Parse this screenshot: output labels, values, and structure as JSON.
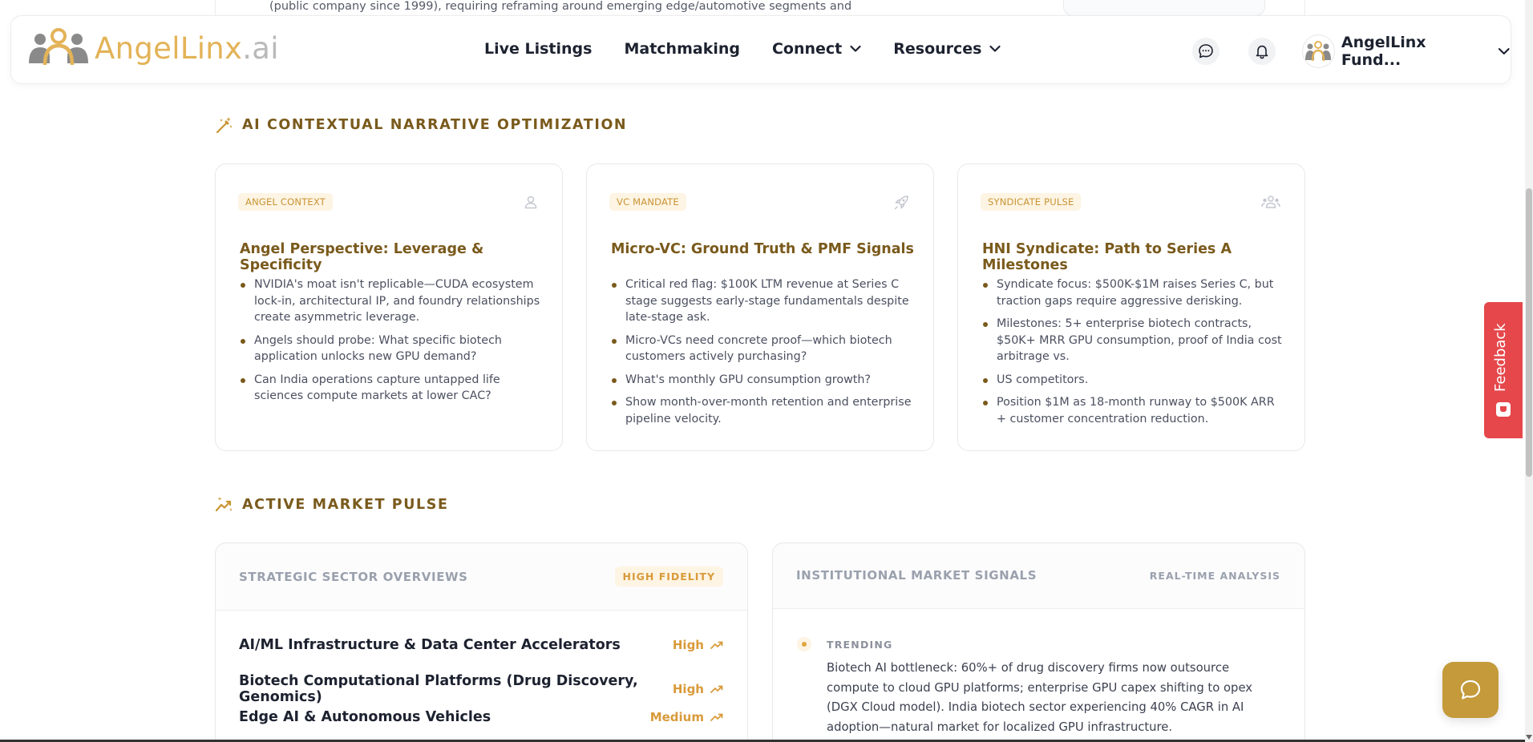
{
  "background_text": "(public company since 1999), requiring reframing around emerging edge/automotive segments and",
  "nav": {
    "logo_main": "AngelLinx",
    "logo_suffix": ".ai",
    "links": [
      {
        "label": "Live Listings"
      },
      {
        "label": "Matchmaking"
      },
      {
        "label": "Connect"
      },
      {
        "label": "Resources"
      }
    ],
    "user_name": "AngelLinx Fund..."
  },
  "narrative": {
    "title": "AI CONTEXTUAL NARRATIVE OPTIMIZATION",
    "cards": [
      {
        "tag": "ANGEL CONTEXT",
        "icon": "user-icon",
        "title": "Angel Perspective: Leverage & Specificity",
        "bullets": [
          "NVIDIA's moat isn't replicable—CUDA ecosystem lock-in, architectural IP, and foundry relationships create asymmetric leverage.",
          "Angels should probe: What specific biotech application unlocks new GPU demand?",
          "Can India operations capture untapped life sciences compute markets at lower CAC?"
        ]
      },
      {
        "tag": "VC MANDATE",
        "icon": "rocket-icon",
        "title": "Micro-VC: Ground Truth & PMF Signals",
        "bullets": [
          "Critical red flag: $100K LTM revenue at Series C stage suggests early-stage fundamentals despite late-stage ask.",
          "Micro-VCs need concrete proof—which biotech customers actively purchasing?",
          "What's monthly GPU consumption growth?",
          "Show month-over-month retention and enterprise pipeline velocity."
        ]
      },
      {
        "tag": "SYNDICATE PULSE",
        "icon": "users-icon",
        "title": "HNI Syndicate: Path to Series A Milestones",
        "bullets": [
          "Syndicate focus: $500K-$1M raises Series C, but traction gaps require aggressive derisking.",
          "Milestones: 5+ enterprise biotech contracts, $50K+ MRR GPU consumption, proof of India cost arbitrage vs.",
          "US competitors.",
          "Position $1M as 18-month runway to $500K ARR + customer concentration reduction."
        ]
      }
    ]
  },
  "market": {
    "title": "ACTIVE MARKET PULSE",
    "sectors_panel": {
      "title": "STRATEGIC SECTOR OVERVIEWS",
      "badge": "HIGH FIDELITY",
      "rows": [
        {
          "name": "AI/ML Infrastructure & Data Center Accelerators",
          "level": "High"
        },
        {
          "name": "Biotech Computational Platforms (Drug Discovery, Genomics)",
          "level": "High"
        },
        {
          "name": "Edge AI & Autonomous Vehicles",
          "level": "Medium"
        }
      ]
    },
    "signals_panel": {
      "title": "INSTITUTIONAL MARKET SIGNALS",
      "right_label": "REAL-TIME ANALYSIS",
      "signal_label": "TRENDING",
      "signal_text": "Biotech AI bottleneck: 60%+ of drug discovery firms now outsource compute to cloud GPU platforms; enterprise GPU capex shifting to opex (DGX Cloud model). India biotech sector experiencing 40% CAGR in AI adoption—natural market for localized GPU infrastructure."
    }
  },
  "feedback_label": "Feedback",
  "colors": {
    "brand_gold": "#e3b358",
    "heading_brown": "#7a5a1c",
    "accent_orange": "#d99a3a",
    "feedback_red": "#e5474b",
    "chat_gold": "#c49a3a"
  }
}
